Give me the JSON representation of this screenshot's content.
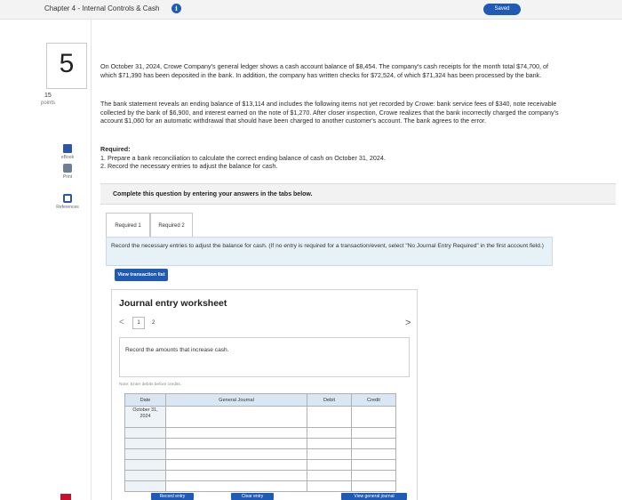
{
  "header": {
    "chapter_title": "Chapter 4 - Internal Controls & Cash",
    "info_icon": "i",
    "saved_label": "Saved"
  },
  "sidebar": {
    "question_number": "5",
    "points_value": "15",
    "points_label": "points",
    "tools": [
      {
        "label": "eBook",
        "icon": "book-icon"
      },
      {
        "label": "Print",
        "icon": "print-icon"
      },
      {
        "label": "References",
        "icon": "references-icon"
      }
    ]
  },
  "problem": {
    "paragraph_1": "On October 31, 2024, Crowe Company's general ledger shows a cash account balance of $8,454. The company's cash receipts for the month total $74,700, of which $71,390 has been deposited in the bank. In addition, the company has written checks for $72,524, of which $71,324 has been processed by the bank.",
    "paragraph_2": "The bank statement reveals an ending balance of $13,114 and includes the following items not yet recorded by Crowe: bank service fees of $340, note receivable collected by the bank of $6,900, and interest earned on the note of $1,270. After closer inspection, Crowe realizes that the bank incorrectly charged the company's account $1,060 for an automatic withdrawal that should have been charged to another customer's account. The bank agrees to the error.",
    "required_heading": "Required:",
    "required_1": "1. Prepare a bank reconciliation to calculate the correct ending balance of cash on October 31, 2024.",
    "required_2": "2. Record the necessary entries to adjust the balance for cash."
  },
  "instruction": "Complete this question by entering your answers in the tabs below.",
  "tabs": [
    "Required 1",
    "Required 2"
  ],
  "required_panel_text": "Record the necessary entries to adjust the balance for cash. (If no entry is required for a transaction/event, select \"No Journal Entry Required\" in the first account field.)",
  "view_transaction_label": "View transaction list",
  "worksheet": {
    "title": "Journal entry worksheet",
    "prev": "<",
    "next": ">",
    "page_current": "1",
    "page_other": "2",
    "record_instruction": "Record the amounts that increase cash.",
    "note": "Note: Enter debits before credits.",
    "columns": [
      "Date",
      "General Journal",
      "Debit",
      "Credit"
    ],
    "first_date_line1": "October 31,",
    "first_date_line2": "2024",
    "buttons": {
      "record": "Record entry",
      "clear": "Clear entry",
      "view_general_journal": "View general journal"
    }
  },
  "colors": {
    "accent_blue": "#1f5bb5",
    "panel_blue": "#e6f1f8",
    "table_header": "#d8e7f3"
  }
}
